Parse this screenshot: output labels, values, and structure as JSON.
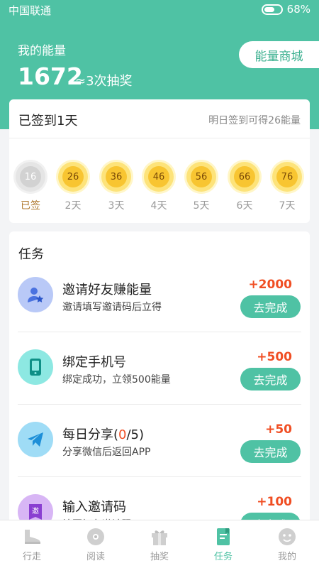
{
  "status_bar": {
    "carrier": "中国联通",
    "battery": "68%"
  },
  "header": {
    "energy_label": "我的能量",
    "energy_value": "1672",
    "energy_approx": "≈3次抽奖",
    "store_button": "能量商城"
  },
  "signin": {
    "title": "已签到1天",
    "tip": "明日签到可得26能量",
    "days": [
      {
        "value": "16",
        "label": "已签"
      },
      {
        "value": "26",
        "label": "2天"
      },
      {
        "value": "36",
        "label": "3天"
      },
      {
        "value": "46",
        "label": "4天"
      },
      {
        "value": "56",
        "label": "5天"
      },
      {
        "value": "66",
        "label": "6天"
      },
      {
        "value": "76",
        "label": "7天"
      }
    ]
  },
  "tasks": {
    "title": "任务",
    "items": [
      {
        "name": "邀请好友赚能量",
        "desc": "邀请填写邀请码后立得",
        "reward": "+2000",
        "button": "去完成",
        "icon": "invite-friend-icon",
        "color": "#b9c9f7"
      },
      {
        "name": "绑定手机号",
        "desc": "绑定成功，立领500能量",
        "reward": "+500",
        "button": "去完成",
        "icon": "phone-icon",
        "color": "#8de8e2"
      },
      {
        "name_prefix": "每日分享(",
        "name_count": "0",
        "name_suffix": "/5)",
        "desc": "分享微信后返回APP",
        "reward": "+50",
        "button": "去完成",
        "icon": "share-plane-icon",
        "color": "#9fdcf6"
      },
      {
        "name": "输入邀请码",
        "desc": "填写好友邀请码",
        "reward": "+100",
        "button": "去完成",
        "icon": "invite-code-icon",
        "color": "#d8b6f5"
      }
    ]
  },
  "tabbar": [
    {
      "label": "行走",
      "icon": "shoe-icon",
      "active": false
    },
    {
      "label": "阅读",
      "icon": "disc-icon",
      "active": false
    },
    {
      "label": "抽奖",
      "icon": "gift-icon",
      "active": false
    },
    {
      "label": "任务",
      "icon": "task-book-icon",
      "active": true
    },
    {
      "label": "我的",
      "icon": "profile-icon",
      "active": false
    }
  ],
  "colors": {
    "brand": "#4fc2a4",
    "reward": "#f04e23"
  }
}
